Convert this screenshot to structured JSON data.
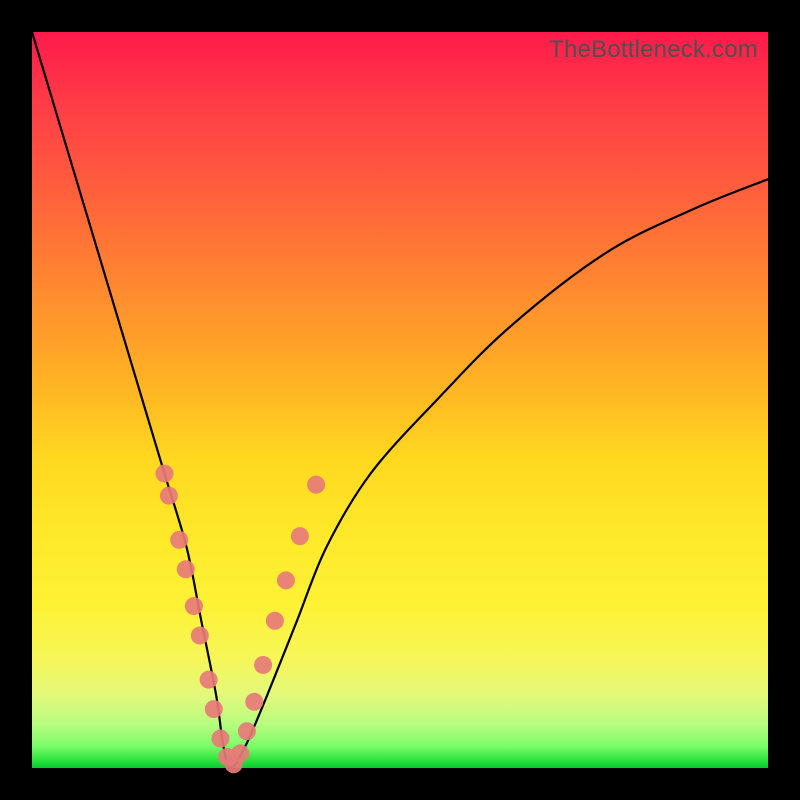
{
  "watermark": "TheBottleneck.com",
  "colors": {
    "frame": "#000000",
    "curve_stroke": "#000000",
    "dot_fill": "#e77a78",
    "gradient_stops": [
      "#ff1a4b",
      "#ff3d46",
      "#ff5a3e",
      "#ff7a34",
      "#ff9a2a",
      "#ffbb22",
      "#ffd820",
      "#ffe82a",
      "#fef235",
      "#f6f658",
      "#e4f97a",
      "#b8fc80",
      "#7dfd6a",
      "#28e33c",
      "#09c62f"
    ]
  },
  "chart_data": {
    "type": "line",
    "title": "",
    "xlabel": "",
    "ylabel": "",
    "xlim": [
      0,
      100
    ],
    "ylim": [
      0,
      100
    ],
    "grid": false,
    "legend": false,
    "series": [
      {
        "name": "bottleneck-curve",
        "x": [
          0,
          3,
          6,
          9,
          12,
          15,
          18,
          21,
          23,
          25,
          26,
          27,
          29,
          32,
          36,
          40,
          46,
          55,
          65,
          78,
          90,
          100
        ],
        "y": [
          100,
          90,
          80,
          70,
          60,
          50,
          40,
          30,
          20,
          10,
          3,
          0,
          3,
          10,
          20,
          30,
          40,
          50,
          60,
          70,
          76,
          80
        ],
        "note": "Approximate V-shaped curve read from pixels: steep descent from top-left to a minimum near x≈27%, then a shallower rise toward the right edge ending around y≈80%."
      }
    ],
    "markers": {
      "name": "sample-dots",
      "x": [
        18.0,
        18.6,
        20.0,
        20.9,
        22.0,
        22.8,
        24.0,
        24.7,
        25.6,
        26.5,
        27.4,
        28.3,
        29.2,
        30.2,
        31.4,
        33.0,
        34.5,
        36.4,
        38.6
      ],
      "y": [
        40.0,
        37.0,
        31.0,
        27.0,
        22.0,
        18.0,
        12.0,
        8.0,
        4.0,
        1.5,
        0.5,
        2.0,
        5.0,
        9.0,
        14.0,
        20.0,
        25.5,
        31.5,
        38.5
      ],
      "note": "Salmon dots clustered along the curve near the trough, both branches."
    }
  }
}
